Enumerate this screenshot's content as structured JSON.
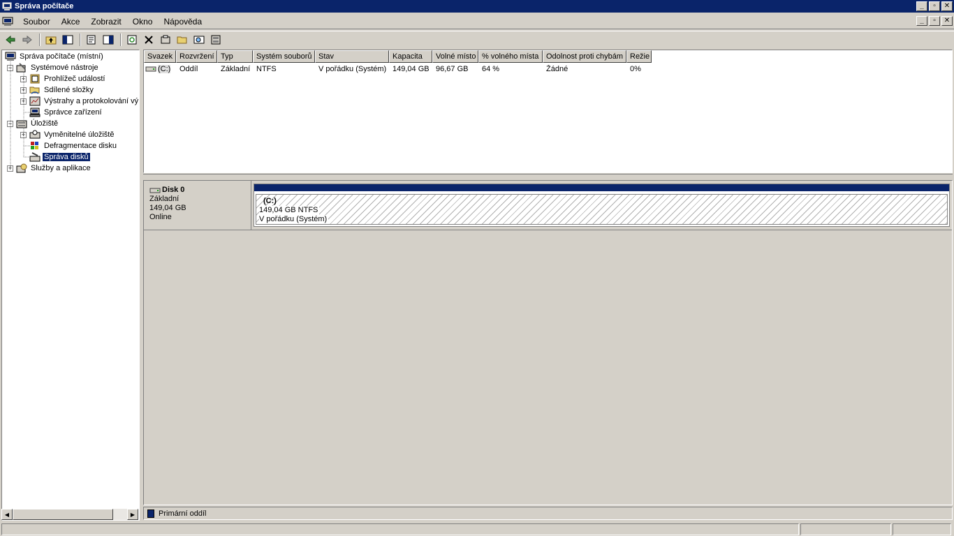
{
  "window": {
    "title": "Správa počítače"
  },
  "menu": {
    "items": [
      "Soubor",
      "Akce",
      "Zobrazit",
      "Okno",
      "Nápověda"
    ]
  },
  "toolbar": {
    "buttons": [
      "back-arrow-icon",
      "forward-arrow-icon",
      "up-folder-icon",
      "show-tree-icon",
      "properties-icon",
      "export-list-icon",
      "refresh-icon",
      "delete-icon",
      "settings-icon",
      "open-folder-icon",
      "search-icon",
      "disk-properties-icon"
    ]
  },
  "tree": {
    "root": "Správa počítače (místní)",
    "system_tools": "Systémové nástroje",
    "event_viewer": "Prohlížeč událostí",
    "shared_folders": "Sdílené složky",
    "alerts": "Výstrahy a protokolování vý",
    "device_manager": "Správce zařízení",
    "storage": "Úložiště",
    "removable_storage": "Vyměnitelné úložiště",
    "defrag": "Defragmentace disku",
    "disk_management": "Správa disků",
    "services": "Služby a aplikace"
  },
  "volumes": {
    "columns": [
      "Svazek",
      "Rozvržení",
      "Typ",
      "Systém souborů",
      "Stav",
      "Kapacita",
      "Volné místo",
      "% volného místa",
      "Odolnost proti chybám",
      "Režie"
    ],
    "rows": [
      {
        "volume": "(C:)",
        "layout": "Oddíl",
        "type": "Základní",
        "filesystem": "NTFS",
        "status": "V pořádku (Systém)",
        "capacity": "149,04 GB",
        "free": "96,67 GB",
        "free_pct": "64 %",
        "fault_tolerance": "Žádné",
        "overhead": "0%"
      }
    ]
  },
  "disk": {
    "name": "Disk 0",
    "type": "Základní",
    "size": "149,04 GB",
    "state": "Online",
    "partition": {
      "name": "(C:)",
      "size_fs": "149,04 GB NTFS",
      "status": "V pořádku (Systém)"
    }
  },
  "legend": {
    "primary": "Primární oddíl",
    "primary_color": "#0a246a"
  }
}
